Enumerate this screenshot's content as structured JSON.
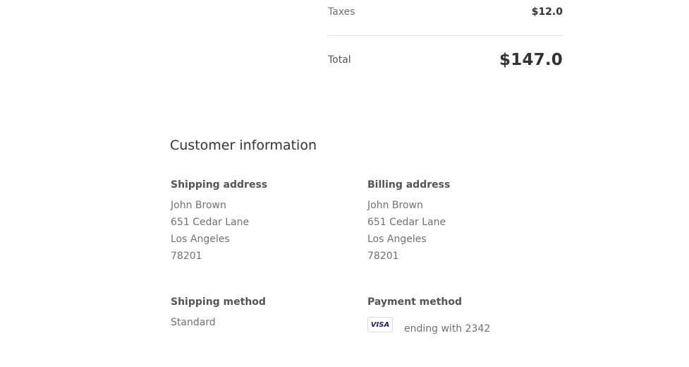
{
  "totals": {
    "taxes_label": "Taxes",
    "taxes_value": "$12.0",
    "total_label": "Total",
    "total_value": "$147.0"
  },
  "customer": {
    "title": "Customer information",
    "shipping_address": {
      "heading": "Shipping address",
      "lines": [
        "John Brown",
        "651 Cedar Lane",
        "Los Angeles",
        "78201"
      ]
    },
    "billing_address": {
      "heading": "Billing address",
      "lines": [
        "John Brown",
        "651 Cedar Lane",
        "Los Angeles",
        "78201"
      ]
    },
    "shipping_method": {
      "heading": "Shipping method",
      "value": "Standard"
    },
    "payment_method": {
      "heading": "Payment method",
      "card_brand": "VISA",
      "card_icon": "visa-card-icon",
      "ending_text": "ending with 2342"
    }
  },
  "colors": {
    "text_primary": "#333333",
    "text_secondary": "#545454",
    "text_muted": "#717171",
    "divider": "#e1e1e1",
    "visa_brand": "#1a1f71"
  }
}
